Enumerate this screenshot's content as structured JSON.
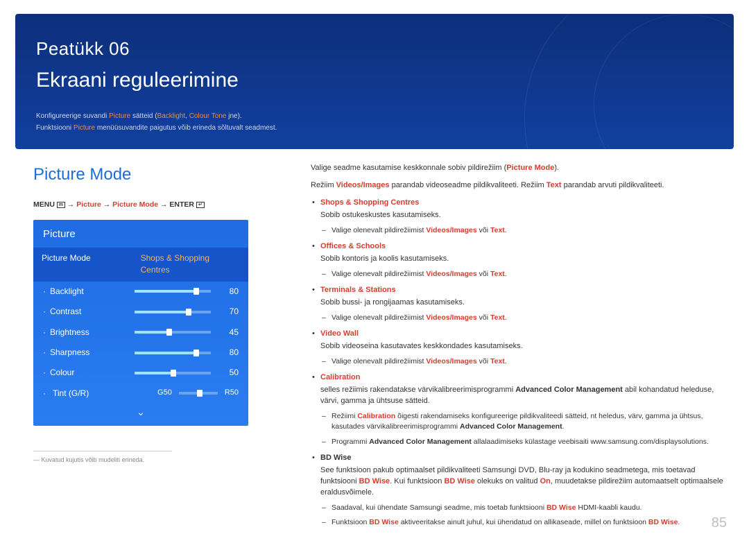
{
  "hero": {
    "chapter": "Peatükk 06",
    "title": "Ekraani reguleerimine",
    "intro_prefix": "Konfigureerige suvandi ",
    "intro_picture": "Picture",
    "intro_mid": " sätteid (",
    "intro_backlight": "Backlight",
    "intro_sep": ", ",
    "intro_colourtone": "Colour Tone",
    "intro_suffix": " jne).",
    "intro_line2a": "Funktsiooni ",
    "intro_line2b": "Picture",
    "intro_line2c": " menüüsuvandite paigutus võib erineda sõltuvalt seadmest."
  },
  "left": {
    "section_title": "Picture Mode",
    "nav_menu": "MENU",
    "nav_arrow": " → ",
    "nav_picture": "Picture",
    "nav_picturemode": "Picture Mode",
    "nav_enter": "ENTER",
    "panel_title": "Picture",
    "row1a": "Picture Mode",
    "row1b": "Shops & Shopping Centres",
    "sliders": [
      {
        "label": "Backlight",
        "value": "80",
        "pct": 80
      },
      {
        "label": "Contrast",
        "value": "70",
        "pct": 70
      },
      {
        "label": "Brightness",
        "value": "45",
        "pct": 45
      },
      {
        "label": "Sharpness",
        "value": "80",
        "pct": 80
      },
      {
        "label": "Colour",
        "value": "50",
        "pct": 50
      }
    ],
    "tint_label": "Tint (G/R)",
    "tint_g": "G50",
    "tint_r": "R50",
    "footnote_dash": "― ",
    "footnote": "Kuvatud kujutis võib mudeliti erineda."
  },
  "right": {
    "p1a": "Valige seadme kasutamise keskkonnale sobiv pildirežiim (",
    "p1b": "Picture Mode",
    "p1c": ").",
    "p2a": "Režiim ",
    "p2b": "Videos/Images",
    "p2c": " parandab videoseadme pildikvaliteeti. Režiim ",
    "p2d": "Text",
    "p2e": " parandab arvuti pildikvaliteeti.",
    "modes": [
      {
        "head": "Shops & Shopping Centres",
        "desc": "Sobib ostukeskustes kasutamiseks.",
        "subs": [
          {
            "a": "Valige olenevalt pildirežiimist ",
            "b": "Videos/Images",
            "c": " või ",
            "d": "Text",
            "e": "."
          }
        ]
      },
      {
        "head": "Offices & Schools",
        "desc": "Sobib kontoris ja koolis kasutamiseks.",
        "subs": [
          {
            "a": "Valige olenevalt pildirežiimist ",
            "b": "Videos/Images",
            "c": " või ",
            "d": "Text",
            "e": "."
          }
        ]
      },
      {
        "head": "Terminals & Stations",
        "desc": "Sobib bussi- ja rongijaamas kasutamiseks.",
        "subs": [
          {
            "a": "Valige olenevalt pildirežiimist ",
            "b": "Videos/Images",
            "c": " või ",
            "d": "Text",
            "e": "."
          }
        ]
      },
      {
        "head": "Video Wall",
        "desc": "Sobib videoseina kasutavates keskkondades kasutamiseks.",
        "subs": [
          {
            "a": "Valige olenevalt pildirežiimist ",
            "b": "Videos/Images",
            "c": " või ",
            "d": "Text",
            "e": "."
          }
        ]
      }
    ],
    "calib_head": "Calibration",
    "calib_desc_a": "selles režiimis rakendatakse värvikalibreerimisprogrammi ",
    "calib_desc_b": "Advanced Color Management",
    "calib_desc_c": " abil kohandatud heleduse, värvi, gamma ja ühtsuse sätteid.",
    "calib_sub1_a": "Režiimi ",
    "calib_sub1_b": "Calibration",
    "calib_sub1_c": " õigesti rakendamiseks konfigureerige pildikvaliteedi sätteid, nt heledus, värv, gamma ja ühtsus, kasutades värvikalibreerimisprogrammi ",
    "calib_sub1_d": "Advanced Color Management",
    "calib_sub1_e": ".",
    "calib_sub2_a": "Programmi ",
    "calib_sub2_b": "Advanced Color Management",
    "calib_sub2_c": " allalaadimiseks külastage veebisaiti www.samsung.com/displaysolutions.",
    "bdwise_head": "BD Wise",
    "bdwise_desc_a": "See funktsioon pakub optimaalset pildikvaliteeti Samsungi DVD, Blu-ray ja kodukino seadmetega, mis toetavad funktsiooni ",
    "bdwise_desc_b": "BD Wise",
    "bdwise_desc_c": ". Kui funktsioon ",
    "bdwise_desc_d": "BD Wise",
    "bdwise_desc_e": " olekuks on valitud ",
    "bdwise_desc_f": "On",
    "bdwise_desc_g": ", muudetakse pildirežiim automaatselt optimaalsele eraldusvõimele.",
    "bdwise_sub1_a": "Saadaval, kui ühendate Samsungi seadme, mis toetab funktsiooni ",
    "bdwise_sub1_b": "BD Wise",
    "bdwise_sub1_c": " HDMI-kaabli kaudu.",
    "bdwise_sub2_a": "Funktsioon ",
    "bdwise_sub2_b": "BD Wise",
    "bdwise_sub2_c": " aktiveeritakse ainult juhul, kui ühendatud on allikaseade, millel on funktsioon ",
    "bdwise_sub2_d": "BD Wise",
    "bdwise_sub2_e": "."
  },
  "pagenum": "85"
}
